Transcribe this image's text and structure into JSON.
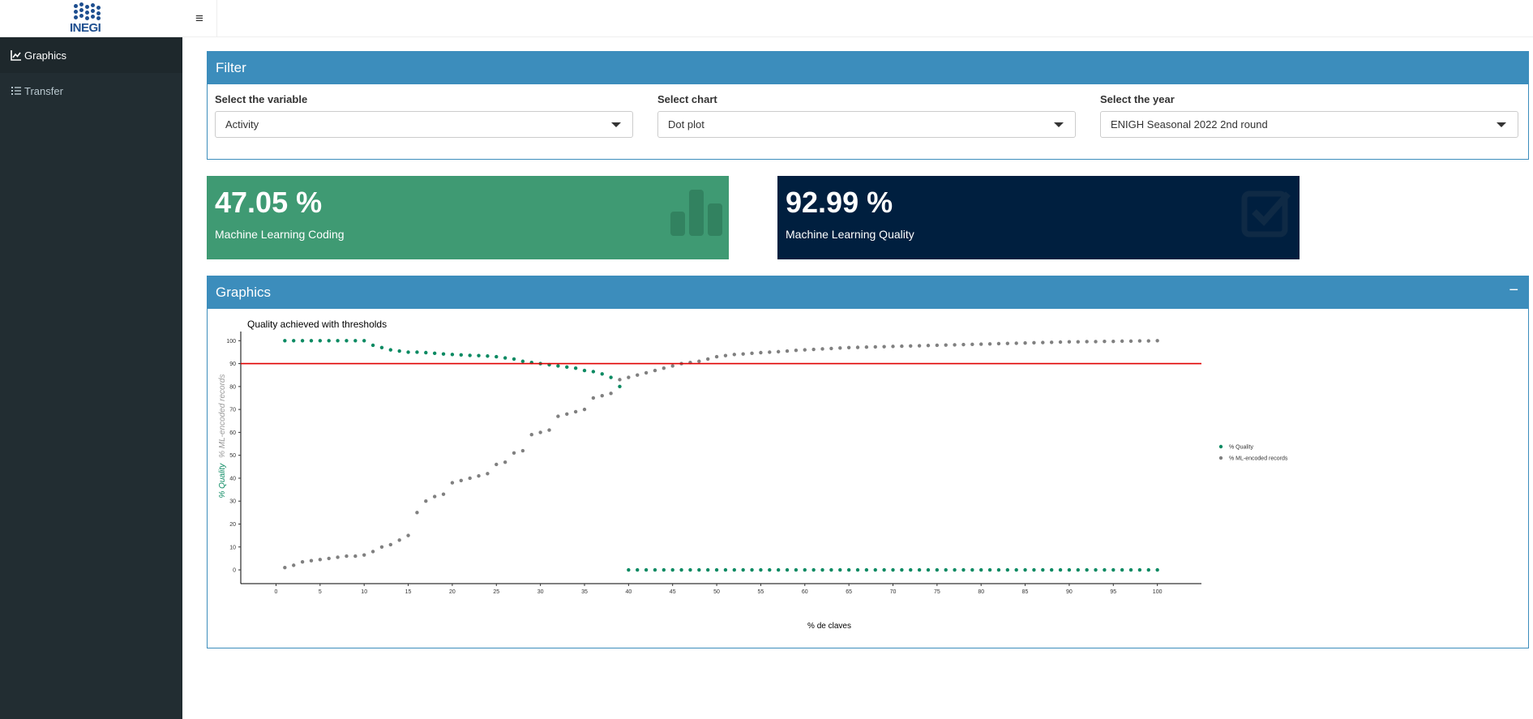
{
  "header": {
    "logo_text": "INEGI"
  },
  "sidebar": {
    "items": [
      {
        "label": "Graphics",
        "icon": "line-chart-icon"
      },
      {
        "label": "Transfer",
        "icon": "list-icon"
      }
    ]
  },
  "topbar": {
    "toggle_glyph": "≡"
  },
  "filter": {
    "title": "Filter",
    "variable": {
      "label": "Select the variable",
      "value": "Activity"
    },
    "chart": {
      "label": "Select chart",
      "value": "Dot plot"
    },
    "year": {
      "label": "Select the year",
      "value": "ENIGH Seasonal 2022 2nd round"
    }
  },
  "value_boxes": [
    {
      "value": "47.05 %",
      "label": "Machine Learning Coding",
      "color": "#3f9a73",
      "icon": "bar-chart-icon"
    },
    {
      "value": "92.99 %",
      "label": "Machine Learning Quality",
      "color": "#001f3f",
      "icon": "check-square-icon"
    }
  ],
  "graphics": {
    "title": "Graphics",
    "collapse_glyph": "−"
  },
  "chart_data": {
    "type": "scatter",
    "title": "Quality achieved with thresholds",
    "xlabel": "% de claves",
    "ylabel_parts": [
      "% Quality",
      "% ML-encoded records"
    ],
    "xlim": [
      -4,
      105
    ],
    "ylim": [
      -6,
      104
    ],
    "xticks": [
      0,
      5,
      10,
      15,
      20,
      25,
      30,
      35,
      40,
      45,
      50,
      55,
      60,
      65,
      70,
      75,
      80,
      85,
      90,
      95,
      100
    ],
    "yticks": [
      0,
      10,
      20,
      30,
      40,
      50,
      60,
      70,
      80,
      90,
      100
    ],
    "hline": {
      "y": 90,
      "color": "#e00000"
    },
    "legend_position": "right",
    "series": [
      {
        "name": "% Quality",
        "color": "#0b8a62",
        "x": [
          1,
          2,
          3,
          4,
          5,
          6,
          7,
          8,
          9,
          10,
          11,
          12,
          13,
          14,
          15,
          16,
          17,
          18,
          19,
          20,
          21,
          22,
          23,
          24,
          25,
          26,
          27,
          28,
          29,
          30,
          31,
          32,
          33,
          34,
          35,
          36,
          37,
          38,
          39,
          40,
          41,
          42,
          43,
          44,
          45,
          46,
          47,
          48,
          49,
          50,
          51,
          52,
          53,
          54,
          55,
          56,
          57,
          58,
          59,
          60,
          61,
          62,
          63,
          64,
          65,
          66,
          67,
          68,
          69,
          70,
          71,
          72,
          73,
          74,
          75,
          76,
          77,
          78,
          79,
          80,
          81,
          82,
          83,
          84,
          85,
          86,
          87,
          88,
          89,
          90,
          91,
          92,
          93,
          94,
          95,
          96,
          97,
          98,
          99,
          100
        ],
        "y": [
          100,
          100,
          100,
          100,
          100,
          100,
          100,
          100,
          100,
          100,
          98,
          97,
          96,
          95.5,
          95,
          95,
          94.8,
          94.5,
          94.2,
          94,
          93.8,
          93.6,
          93.5,
          93.3,
          93,
          92.5,
          92,
          91,
          90.5,
          90,
          89.5,
          89,
          88.5,
          88,
          87,
          86.5,
          85.5,
          84,
          80,
          0,
          0,
          0,
          0,
          0,
          0,
          0,
          0,
          0,
          0,
          0,
          0,
          0,
          0,
          0,
          0,
          0,
          0,
          0,
          0,
          0,
          0,
          0,
          0,
          0,
          0,
          0,
          0,
          0,
          0,
          0,
          0,
          0,
          0,
          0,
          0,
          0,
          0,
          0,
          0,
          0,
          0,
          0,
          0,
          0,
          0,
          0,
          0,
          0,
          0,
          0,
          0,
          0,
          0,
          0,
          0,
          0,
          0,
          0,
          0,
          0
        ]
      },
      {
        "name": "% ML-encoded records",
        "color": "#808080",
        "x": [
          1,
          2,
          3,
          4,
          5,
          6,
          7,
          8,
          9,
          10,
          11,
          12,
          13,
          14,
          15,
          16,
          17,
          18,
          19,
          20,
          21,
          22,
          23,
          24,
          25,
          26,
          27,
          28,
          29,
          30,
          31,
          32,
          33,
          34,
          35,
          36,
          37,
          38,
          39,
          40,
          41,
          42,
          43,
          44,
          45,
          46,
          47,
          48,
          49,
          50,
          51,
          52,
          53,
          54,
          55,
          56,
          57,
          58,
          59,
          60,
          61,
          62,
          63,
          64,
          65,
          66,
          67,
          68,
          69,
          70,
          71,
          72,
          73,
          74,
          75,
          76,
          77,
          78,
          79,
          80,
          81,
          82,
          83,
          84,
          85,
          86,
          87,
          88,
          89,
          90,
          91,
          92,
          93,
          94,
          95,
          96,
          97,
          98,
          99,
          100
        ],
        "y": [
          1,
          2,
          3.5,
          4,
          4.5,
          5,
          5.5,
          6,
          6,
          6.5,
          8,
          10,
          11,
          13,
          15,
          25,
          30,
          32,
          33,
          38,
          39,
          40,
          41,
          42,
          46,
          47,
          51,
          52,
          59,
          60,
          61,
          67,
          68,
          69,
          70,
          75,
          76,
          77,
          83,
          84,
          85,
          86,
          87,
          88,
          89,
          90,
          90.5,
          91,
          92,
          93,
          93.5,
          94,
          94.2,
          94.5,
          94.8,
          95,
          95.2,
          95.5,
          95.8,
          96,
          96.2,
          96.4,
          96.6,
          96.8,
          97,
          97.1,
          97.2,
          97.3,
          97.4,
          97.5,
          97.6,
          97.7,
          97.8,
          97.9,
          98,
          98.1,
          98.2,
          98.3,
          98.4,
          98.5,
          98.6,
          98.7,
          98.8,
          98.9,
          99,
          99.1,
          99.2,
          99.3,
          99.4,
          99.5,
          99.5,
          99.6,
          99.6,
          99.7,
          99.7,
          99.8,
          99.8,
          99.9,
          99.9,
          100
        ]
      }
    ]
  }
}
